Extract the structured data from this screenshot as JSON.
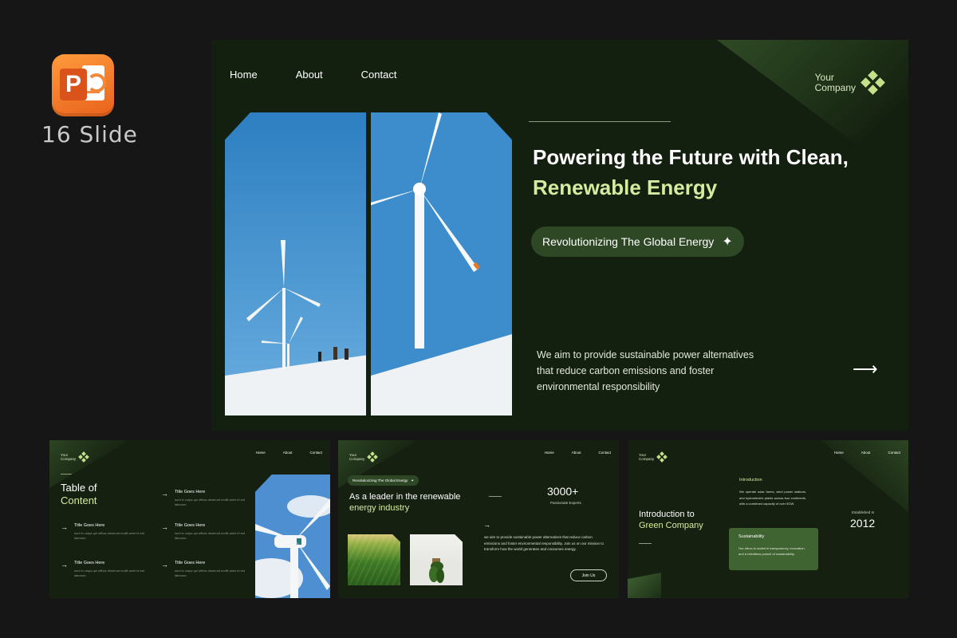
{
  "badge": {
    "slide_count": "16 Slide",
    "app_icon": "powerpoint-icon",
    "app_letter": "P"
  },
  "colors": {
    "background": "#161616",
    "slide_bg": "#14200f",
    "accent": "#d5ec9e",
    "pill": "#2e4826"
  },
  "main": {
    "nav": [
      "Home",
      "About",
      "Contact"
    ],
    "brand": {
      "line1": "Your",
      "line2": "Company"
    },
    "headline_line1": "Powering the Future with Clean,",
    "headline_line2": "Renewable Energy",
    "pill_label": "Revolutionizing The Global Energy",
    "description": "We aim to provide sustainable power alternatives that reduce carbon emissions and foster environmental responsibility"
  },
  "thumb1": {
    "brand": {
      "line1": "Your",
      "line2": "Company"
    },
    "nav": [
      "Home",
      "About",
      "Contact"
    ],
    "title_line1": "Table of",
    "title_line2": "Content",
    "items": [
      {
        "heading": "Title Goes Here",
        "body": "sunt in culpa qui officia deserunt mollit anim id est laborum."
      },
      {
        "heading": "Title Goes Here",
        "body": "sunt in culpa qui officia deserunt mollit anim id est laborum."
      },
      {
        "heading": "Title Goes Here",
        "body": "sunt in culpa qui officia deserunt mollit anim id est laborum."
      },
      {
        "heading": "Title Goes Here",
        "body": "sunt in culpa qui officia deserunt mollit anim id est laborum."
      },
      {
        "heading": "Title Goes Here",
        "body": "sunt in culpa qui officia deserunt mollit anim id est laborum."
      }
    ]
  },
  "thumb2": {
    "brand": {
      "line1": "Your",
      "line2": "Company"
    },
    "nav": [
      "Home",
      "About",
      "Contact"
    ],
    "pill_label": "Revolutionizing The Global Energy",
    "title_line1": "As a leader in the renewable",
    "title_line2": "energy industry",
    "stat_value": "3000+",
    "stat_label": "Passionate Experts",
    "paragraph": "we aim to provide sustainable power alternatives that reduce carbon emissions and foster environmental responsibility. Join us on our mission to transform how the world generates and consumes energy.",
    "button": "Join Us"
  },
  "thumb3": {
    "brand": {
      "line1": "Your",
      "line2": "Company"
    },
    "nav": [
      "Home",
      "About",
      "Contact"
    ],
    "title_line1": "Introduction to",
    "title_line2": "Green Company",
    "intro_heading": "Introduction",
    "intro_body": "We operate solar farms, wind power stations, and hydroelectric plants across four continents, with a combined capacity of over 5GW.",
    "established_label": "Established In",
    "year": "2012",
    "card_heading": "Sustainability",
    "card_body": "Our ethos is rooted in transparency, innovation, and a relentless pursuit of sustainability."
  }
}
